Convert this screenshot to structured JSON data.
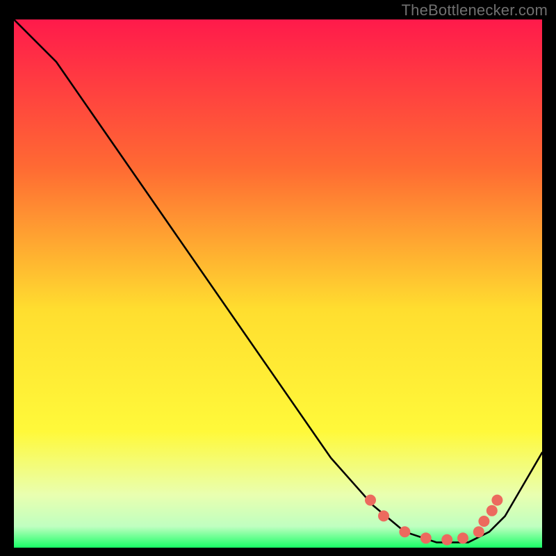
{
  "attribution": "TheBottlenecker.com",
  "colors": {
    "bg": "#000000",
    "curve": "#000000",
    "dot": "#ec6a5e",
    "gradient_top": "#ff1a4b",
    "gradient_mid_upper": "#ff7a2e",
    "gradient_mid": "#ffde2f",
    "gradient_mid_lower": "#f9ff60",
    "gradient_low": "#e9ffb0",
    "gradient_bottom": "#19ff66"
  },
  "chart_data": {
    "type": "line",
    "title": "",
    "xlabel": "",
    "ylabel": "",
    "xlim": [
      0,
      100
    ],
    "ylim": [
      0,
      100
    ],
    "curve": {
      "x": [
        0,
        4,
        8,
        60,
        68,
        74,
        80,
        86,
        90,
        93,
        100
      ],
      "y": [
        100,
        96,
        92,
        17,
        8,
        3,
        1,
        1,
        3,
        6,
        18
      ]
    },
    "dots": {
      "x": [
        67.5,
        70,
        74,
        78,
        82,
        85,
        88,
        89,
        90.5,
        91.5
      ],
      "y": [
        9,
        6,
        3,
        1.8,
        1.5,
        1.8,
        3,
        5,
        7,
        9
      ]
    }
  }
}
